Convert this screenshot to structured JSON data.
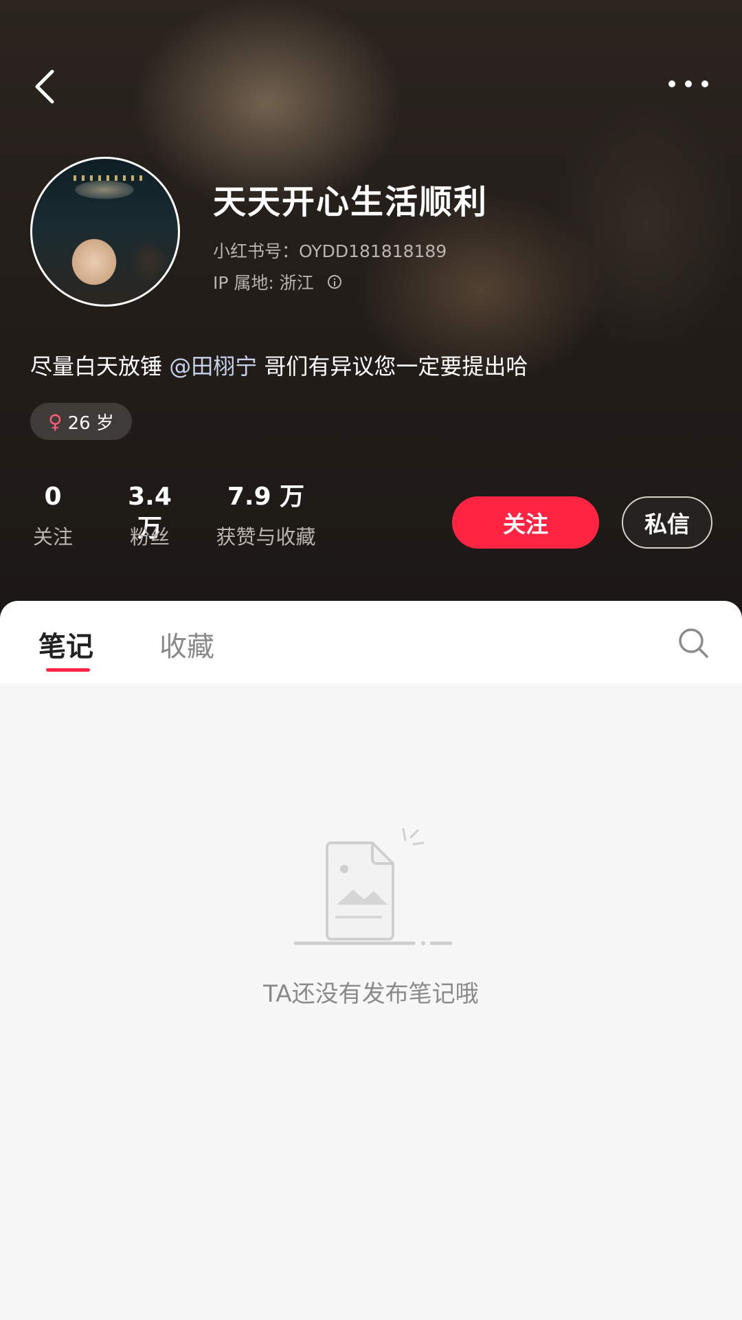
{
  "header": {
    "username": "天天开心生活顺利",
    "xhs_id": "小红书号：OYDD181818189",
    "ip_location": "IP 属地: 浙江",
    "bio_prefix": "尽量白天放锤 ",
    "bio_mention": "@田栩宁",
    "bio_suffix": " 哥们有异议您一定要提出哈",
    "gender_symbol": "♀",
    "age": "26 岁"
  },
  "stats": [
    {
      "value": "0",
      "label": "关注"
    },
    {
      "value": "3.4 万",
      "label": "粉丝"
    },
    {
      "value": "7.9 万",
      "label": "获赞与收藏"
    }
  ],
  "buttons": {
    "follow": "关注",
    "message": "私信"
  },
  "tabs": [
    {
      "label": "笔记",
      "active": true
    },
    {
      "label": "收藏",
      "active": false
    }
  ],
  "empty_state": {
    "message": "TA还没有发布笔记哦"
  },
  "colors": {
    "accent": "#ff2442",
    "header_bg": "#241e1a",
    "content_bg": "#f7f7f7"
  },
  "icons": [
    "back-icon",
    "more-icon",
    "info-icon",
    "female-icon",
    "search-icon",
    "empty-notes-illustration"
  ]
}
